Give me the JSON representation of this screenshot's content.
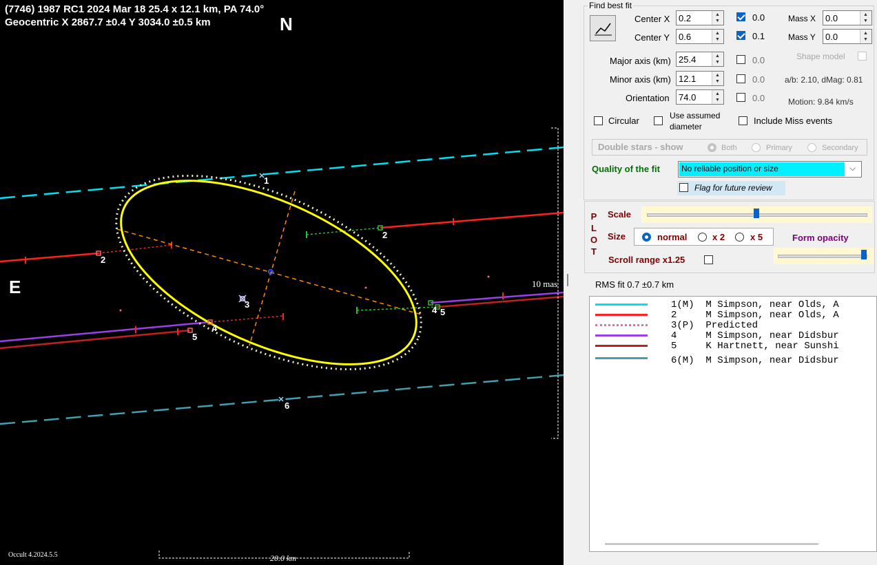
{
  "plot": {
    "title_line1": "(7746) 1987 RC1  2024 Mar 18  25.4 x 12.1 km, PA 74.0°",
    "title_line2": "Geocentric  X  2867.7 ±0.4  Y 3034.0 ±0.5 km",
    "north_label": "N",
    "east_label": "E",
    "version": "Occult 4.2024.5.5",
    "scale_10mas": "10 mas",
    "scale_km": "20.0 km",
    "chord_labels": [
      "1",
      "2",
      "2",
      "3",
      "4",
      "4",
      "5",
      "5",
      "6"
    ],
    "colors": {
      "chord1": "#00e0f0",
      "chord2": "#ff2020",
      "chord4": "#9a40e8",
      "chord5": "#c02020",
      "chord6": "#40a0b0",
      "ellipse": "#ffff00",
      "axes": "#ff8c00",
      "predicted": "#ff6090"
    }
  },
  "panel": {
    "find_best_fit": "Find best fit",
    "center_x": {
      "label": "Center X",
      "value": "0.2",
      "check_value": "0.0",
      "checked": true
    },
    "center_y": {
      "label": "Center Y",
      "value": "0.6",
      "check_value": "0.1",
      "checked": true
    },
    "mass_x": {
      "label": "Mass X",
      "value": "0.0"
    },
    "mass_y": {
      "label": "Mass Y",
      "value": "0.0"
    },
    "shape_model": "Shape model",
    "major_axis": {
      "label": "Major axis (km)",
      "value": "25.4",
      "check_value": "0.0"
    },
    "minor_axis": {
      "label": "Minor axis (km)",
      "value": "12.1",
      "check_value": "0.0"
    },
    "orientation": {
      "label": "Orientation",
      "value": "74.0",
      "check_value": "0.0"
    },
    "ab_dmag": "a/b: 2.10, dMag: 0.81",
    "motion": "Motion: 9.84 km/s",
    "circular": "Circular",
    "use_assumed_1": "Use assumed",
    "use_assumed_2": "diameter",
    "include_miss": "Include Miss events",
    "double_stars": "Double stars - show",
    "both": "Both",
    "primary": "Primary",
    "secondary": "Secondary",
    "quality_label": "Quality of the fit",
    "quality_value": "No reliable position or size",
    "flag_review": "Flag for future review",
    "plot_letters": [
      "P",
      "L",
      "O",
      "T"
    ],
    "scale": "Scale",
    "size": "Size",
    "size_normal": "normal",
    "size_x2": "x 2",
    "size_x5": "x 5",
    "form_opacity": "Form opacity",
    "scroll_range": "Scroll range x1.25",
    "rms_fit": "RMS fit 0.7 ±0.7 km",
    "legend": [
      {
        "text": "1(M)  M Simpson, near Olds, A",
        "color": "#00e0f0",
        "style": "solid"
      },
      {
        "text": "2     M Simpson, near Olds, A",
        "color": "#ff2020",
        "style": "solid"
      },
      {
        "text": "3(P)  Predicted",
        "color": "#ff6090",
        "style": "dotted"
      },
      {
        "text": "4     M Simpson, near Didsbur",
        "color": "#9a40e8",
        "style": "solid"
      },
      {
        "text": "5     K Hartnett, near Sunshi",
        "color": "#c02020",
        "style": "solid"
      },
      {
        "text": "6(M)  M Simpson, near Didsbur",
        "color": "#40a0b0",
        "style": "solid"
      }
    ]
  }
}
